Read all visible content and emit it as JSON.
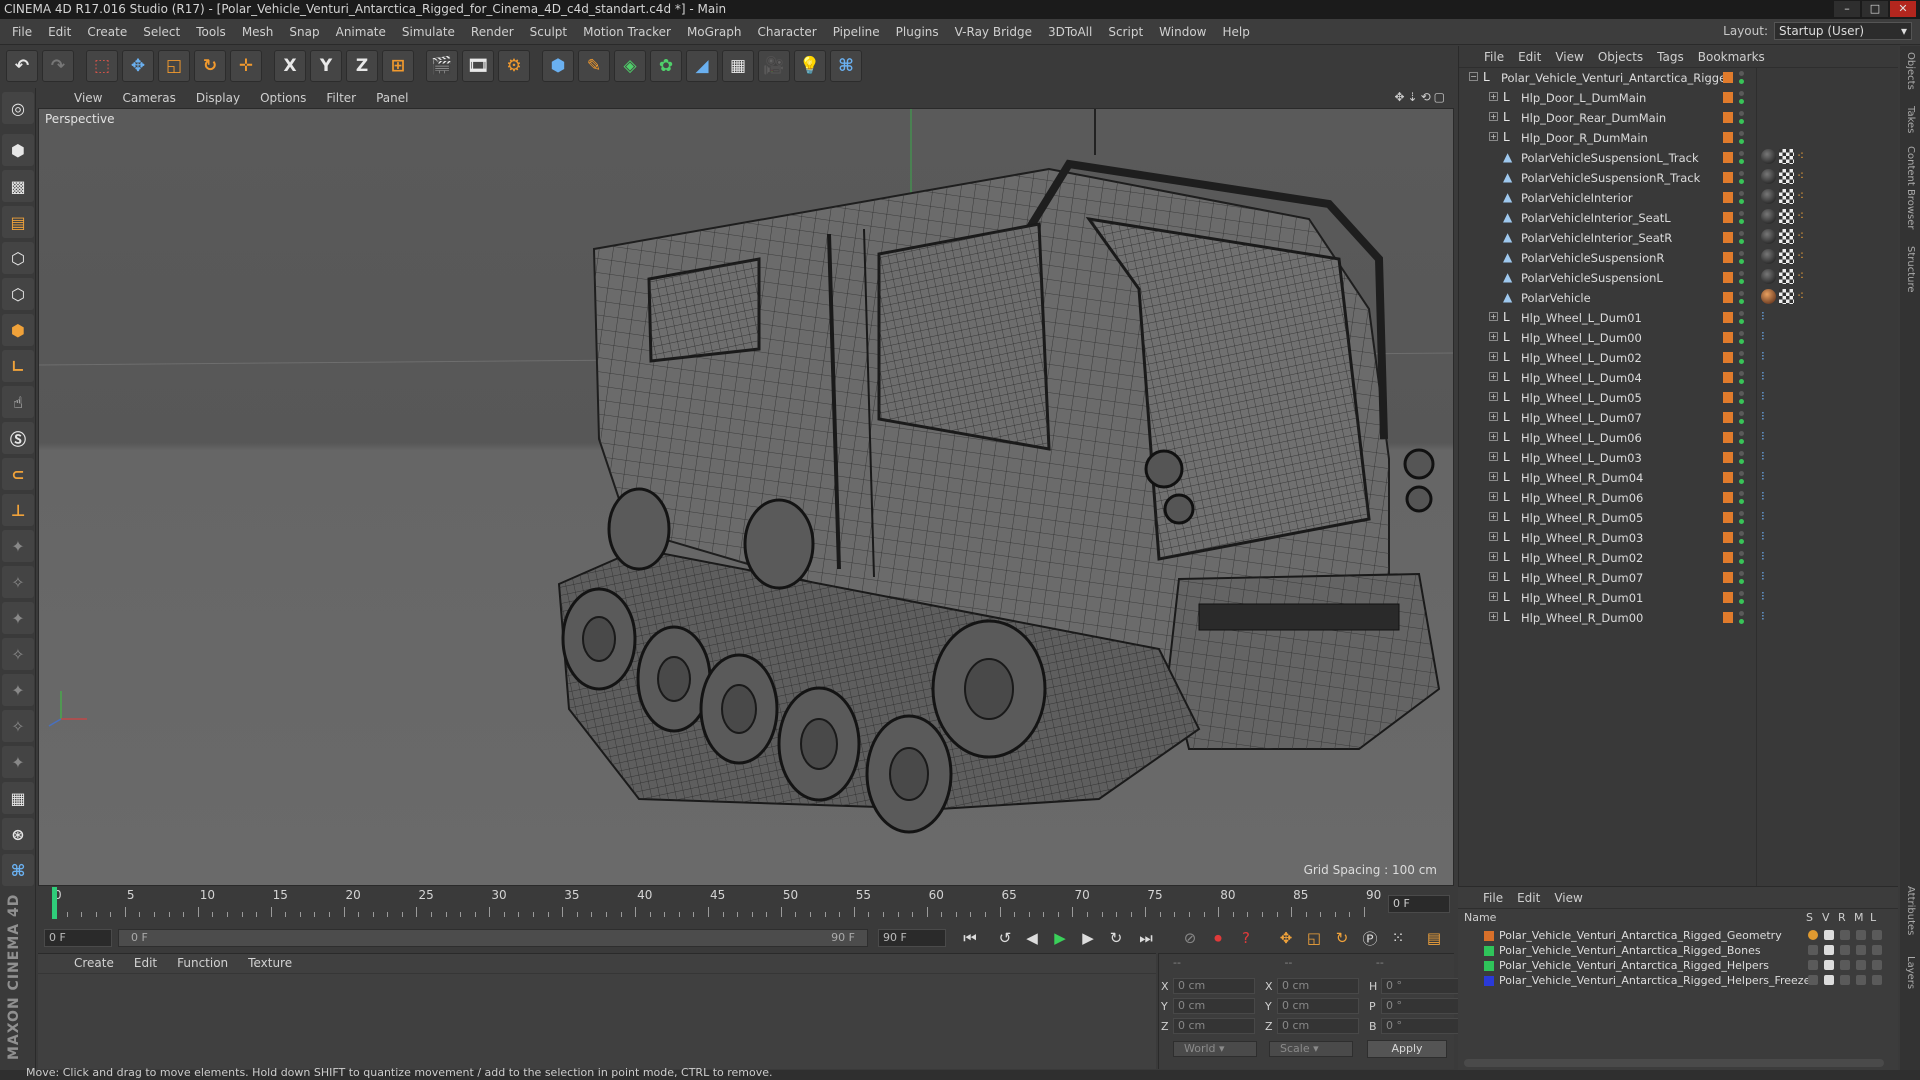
{
  "window": {
    "title": "CINEMA 4D R17.016 Studio (R17) - [Polar_Vehicle_Venturi_Antarctica_Rigged_for_Cinema_4D_c4d_standart.c4d *] - Main"
  },
  "menubar": {
    "items": [
      "File",
      "Edit",
      "Create",
      "Select",
      "Tools",
      "Mesh",
      "Snap",
      "Animate",
      "Simulate",
      "Render",
      "Sculpt",
      "Motion Tracker",
      "MoGraph",
      "Character",
      "Pipeline",
      "Plugins",
      "V-Ray Bridge",
      "3DToAll",
      "Script",
      "Window",
      "Help"
    ],
    "layout_label": "Layout:",
    "layout_value": "Startup (User)"
  },
  "toolbar": {
    "axis_x": "X",
    "axis_y": "Y",
    "axis_z": "Z"
  },
  "viewport": {
    "menu": [
      "View",
      "Cameras",
      "Display",
      "Options",
      "Filter",
      "Panel"
    ],
    "label": "Perspective",
    "grid_spacing": "Grid Spacing : 100 cm"
  },
  "timeline": {
    "ticks": [
      "0",
      "5",
      "10",
      "15",
      "20",
      "25",
      "30",
      "35",
      "40",
      "45",
      "50",
      "55",
      "60",
      "65",
      "70",
      "75",
      "80",
      "85",
      "90"
    ],
    "current_frame": "0 F",
    "start_field": "0 F",
    "range_start": "0 F",
    "range_end": "90 F",
    "end_field": "90 F"
  },
  "material_manager": {
    "menu": [
      "Create",
      "Edit",
      "Function",
      "Texture"
    ]
  },
  "coordinates": {
    "header_left": "--",
    "header_mid": "--",
    "header_right": "--",
    "x_pos": "0 cm",
    "y_pos": "0 cm",
    "z_pos": "0 cm",
    "x_size": "0 cm",
    "y_size": "0 cm",
    "z_size": "0 cm",
    "h": "0 °",
    "p": "0 °",
    "b": "0 °",
    "label_x": "X",
    "label_y": "Y",
    "label_z": "Z",
    "label_h": "H",
    "label_p": "P",
    "label_b": "B",
    "mode": "World",
    "scale": "Scale",
    "apply": "Apply"
  },
  "status": {
    "text": "Move: Click and drag to move elements. Hold down SHIFT to quantize movement / add to the selection in point mode, CTRL to remove."
  },
  "object_manager": {
    "menu": [
      "File",
      "Edit",
      "View",
      "Objects",
      "Tags",
      "Bookmarks"
    ],
    "objects": [
      {
        "name": "Polar_Vehicle_Venturi_Antarctica_Rigged",
        "type": "null",
        "tags": []
      },
      {
        "name": "Hlp_Door_L_DumMain",
        "type": "null",
        "tags": []
      },
      {
        "name": "Hlp_Door_Rear_DumMain",
        "type": "null",
        "tags": []
      },
      {
        "name": "Hlp_Door_R_DumMain",
        "type": "null",
        "tags": []
      },
      {
        "name": "PolarVehicleSuspensionL_Track",
        "type": "mesh",
        "tags": [
          "material",
          "checker",
          "points"
        ]
      },
      {
        "name": "PolarVehicleSuspensionR_Track",
        "type": "mesh",
        "tags": [
          "material",
          "checker",
          "points"
        ]
      },
      {
        "name": "PolarVehicleInterior",
        "type": "mesh",
        "tags": [
          "material",
          "checker",
          "points"
        ]
      },
      {
        "name": "PolarVehicleInterior_SeatL",
        "type": "mesh",
        "tags": [
          "material",
          "checker",
          "points"
        ]
      },
      {
        "name": "PolarVehicleInterior_SeatR",
        "type": "mesh",
        "tags": [
          "material",
          "checker",
          "points"
        ]
      },
      {
        "name": "PolarVehicleSuspensionR",
        "type": "mesh",
        "tags": [
          "material",
          "checker",
          "points"
        ]
      },
      {
        "name": "PolarVehicleSuspensionL",
        "type": "mesh",
        "tags": [
          "material",
          "checker",
          "points"
        ]
      },
      {
        "name": "PolarVehicle",
        "type": "mesh",
        "tags": [
          "material-orange",
          "checker",
          "points"
        ]
      },
      {
        "name": "Hlp_Wheel_L_Dum01",
        "type": "null",
        "tags": [
          "rig"
        ]
      },
      {
        "name": "Hlp_Wheel_L_Dum00",
        "type": "null",
        "tags": [
          "rig"
        ]
      },
      {
        "name": "Hlp_Wheel_L_Dum02",
        "type": "null",
        "tags": [
          "rig"
        ]
      },
      {
        "name": "Hlp_Wheel_L_Dum04",
        "type": "null",
        "tags": [
          "rig"
        ]
      },
      {
        "name": "Hlp_Wheel_L_Dum05",
        "type": "null",
        "tags": [
          "rig"
        ]
      },
      {
        "name": "Hlp_Wheel_L_Dum07",
        "type": "null",
        "tags": [
          "rig"
        ]
      },
      {
        "name": "Hlp_Wheel_L_Dum06",
        "type": "null",
        "tags": [
          "rig"
        ]
      },
      {
        "name": "Hlp_Wheel_L_Dum03",
        "type": "null",
        "tags": [
          "rig"
        ]
      },
      {
        "name": "Hlp_Wheel_R_Dum04",
        "type": "null",
        "tags": [
          "rig"
        ]
      },
      {
        "name": "Hlp_Wheel_R_Dum06",
        "type": "null",
        "tags": [
          "rig"
        ]
      },
      {
        "name": "Hlp_Wheel_R_Dum05",
        "type": "null",
        "tags": [
          "rig"
        ]
      },
      {
        "name": "Hlp_Wheel_R_Dum03",
        "type": "null",
        "tags": [
          "rig"
        ]
      },
      {
        "name": "Hlp_Wheel_R_Dum02",
        "type": "null",
        "tags": [
          "rig"
        ]
      },
      {
        "name": "Hlp_Wheel_R_Dum07",
        "type": "null",
        "tags": [
          "rig"
        ]
      },
      {
        "name": "Hlp_Wheel_R_Dum01",
        "type": "null",
        "tags": [
          "rig"
        ]
      },
      {
        "name": "Hlp_Wheel_R_Dum00",
        "type": "null",
        "tags": [
          "rig"
        ]
      }
    ]
  },
  "layer_manager": {
    "menu": [
      "File",
      "Edit",
      "View"
    ],
    "header_name": "Name",
    "columns": [
      "S",
      "V",
      "R",
      "M",
      "L"
    ],
    "layers": [
      {
        "name": "Polar_Vehicle_Venturi_Antarctica_Rigged_Geometry",
        "color": "#d8702a"
      },
      {
        "name": "Polar_Vehicle_Venturi_Antarctica_Rigged_Bones",
        "color": "#2fc45a"
      },
      {
        "name": "Polar_Vehicle_Venturi_Antarctica_Rigged_Helpers",
        "color": "#2fc45a"
      },
      {
        "name": "Polar_Vehicle_Venturi_Antarctica_Rigged_Helpers_Freeze",
        "color": "#2a3ad8"
      }
    ]
  },
  "right_tabs": [
    "Objects",
    "Takes",
    "Content Browser",
    "Structure"
  ],
  "right_tabs_lower": [
    "Attributes",
    "Layers"
  ],
  "brand": "MAXON CINEMA 4D",
  "colors": {
    "accent_orange": "#e07b2c",
    "playhead_green": "#2fcc7a"
  }
}
